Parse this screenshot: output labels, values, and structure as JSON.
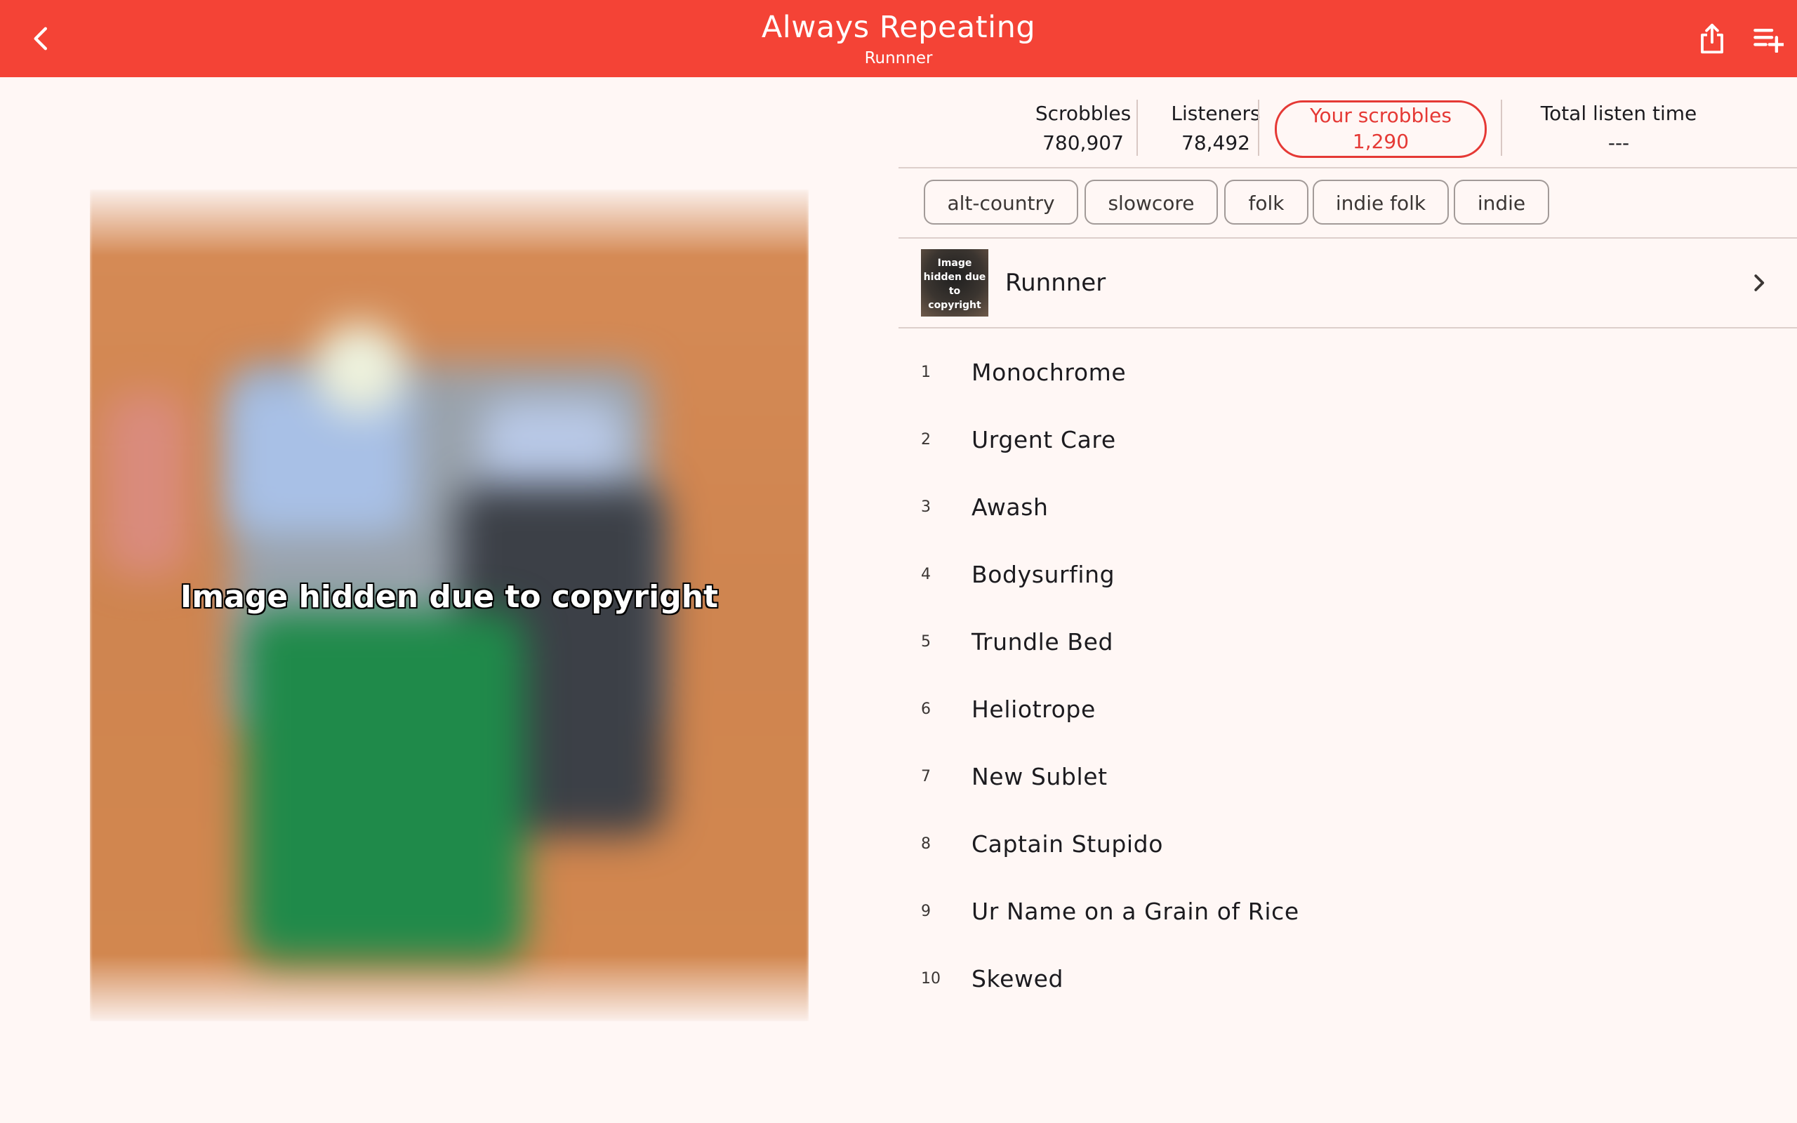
{
  "appbar": {
    "title": "Always Repeating",
    "subtitle": "Runnner"
  },
  "artwork": {
    "caption": "Image hidden due to copyright"
  },
  "stats": {
    "scrobbles": {
      "label": "Scrobbles",
      "value": "780,907"
    },
    "listeners": {
      "label": "Listeners",
      "value": "78,492"
    },
    "your_scrobbles": {
      "label": "Your scrobbles",
      "value": "1,290"
    },
    "total_listen_time": {
      "label": "Total listen time",
      "value": "---"
    }
  },
  "tags": [
    "alt-country",
    "slowcore",
    "folk",
    "indie folk",
    "indie"
  ],
  "artist": {
    "name": "Runnner",
    "thumb_caption": "Image hidden due to copyright"
  },
  "tracks": [
    {
      "num": "1",
      "title": "Monochrome"
    },
    {
      "num": "2",
      "title": "Urgent Care"
    },
    {
      "num": "3",
      "title": "Awash"
    },
    {
      "num": "4",
      "title": "Bodysurfing"
    },
    {
      "num": "5",
      "title": "Trundle Bed"
    },
    {
      "num": "6",
      "title": "Heliotrope"
    },
    {
      "num": "7",
      "title": "New Sublet"
    },
    {
      "num": "8",
      "title": "Captain Stupido"
    },
    {
      "num": "9",
      "title": "Ur Name on a Grain of Rice"
    },
    {
      "num": "10",
      "title": "Skewed"
    }
  ],
  "colors": {
    "appbar": "#f44336",
    "accent": "#e53935",
    "background": "#fff7f5"
  },
  "icons": {
    "back": "chevron-left-icon",
    "share": "share-icon",
    "add_to_queue": "playlist-add-icon",
    "artist_open": "chevron-right-icon"
  }
}
